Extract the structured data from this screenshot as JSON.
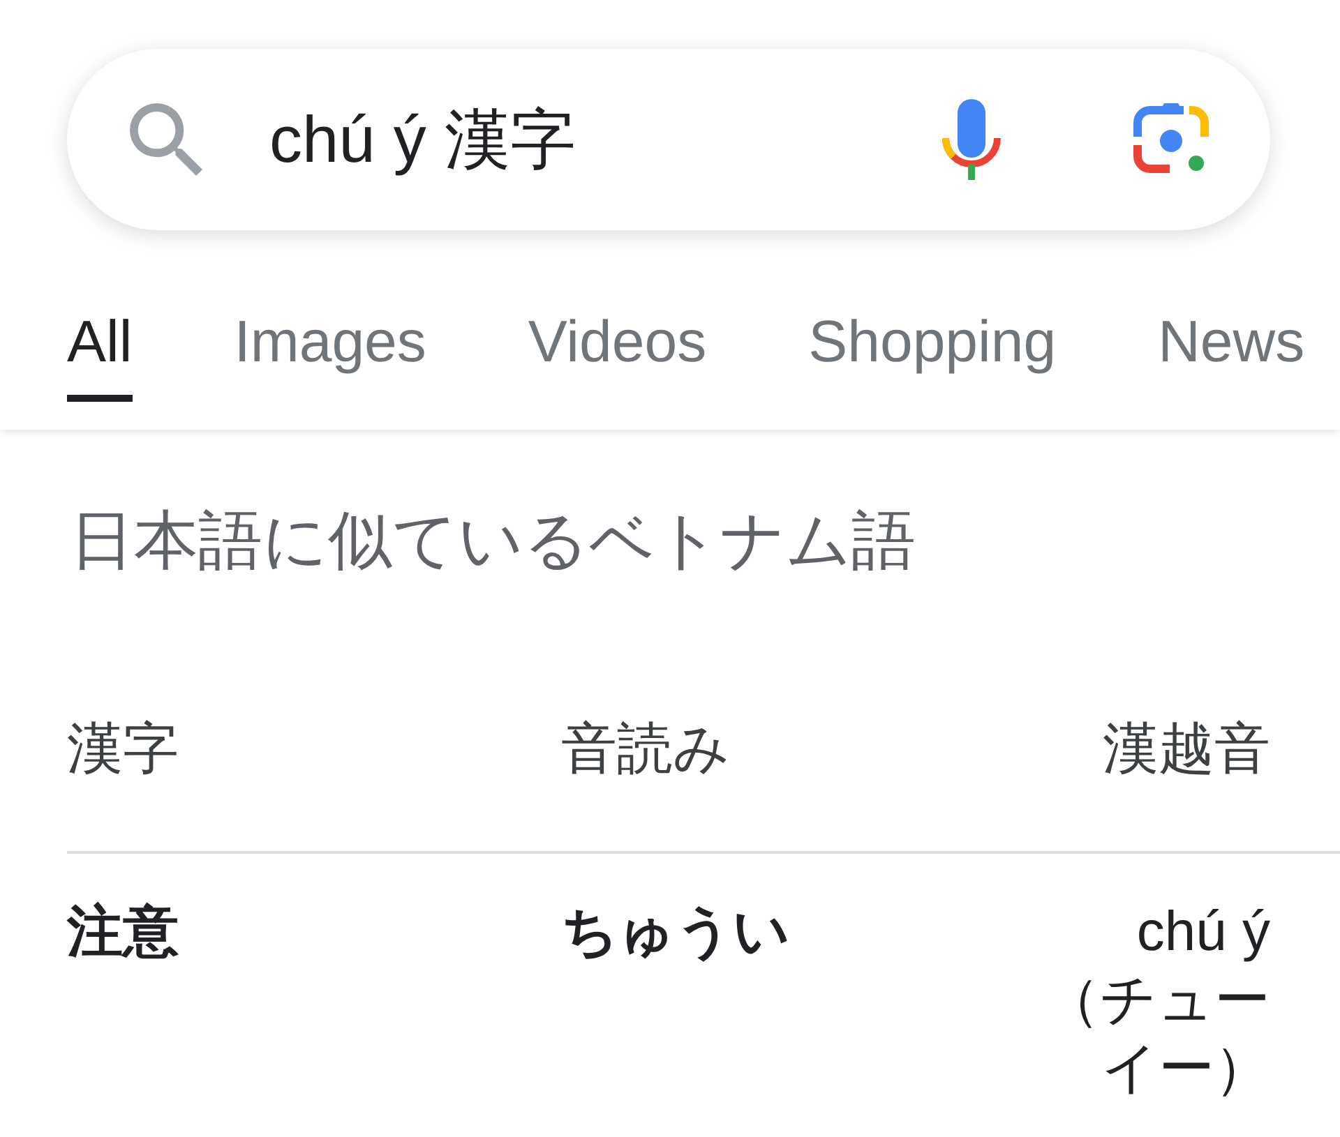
{
  "search": {
    "query": "chú ý 漢字"
  },
  "tabs": [
    {
      "label": "All",
      "selected": true
    },
    {
      "label": "Images",
      "selected": false
    },
    {
      "label": "Videos",
      "selected": false
    },
    {
      "label": "Shopping",
      "selected": false
    },
    {
      "label": "News",
      "selected": false
    }
  ],
  "heading": "日本語に似ているベトナム語",
  "table": {
    "columns": [
      "漢字",
      "音読み",
      "漢越音"
    ],
    "rows": [
      [
        "注意",
        "ちゅうい",
        "chú ý（チューイー）"
      ]
    ]
  }
}
